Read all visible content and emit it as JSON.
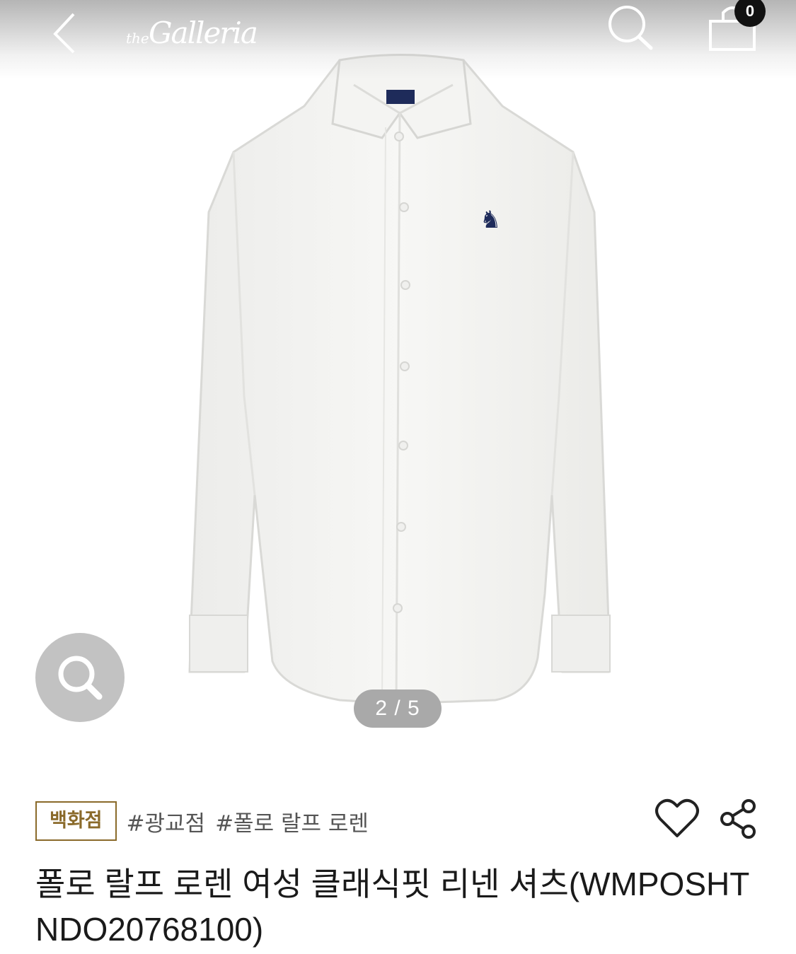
{
  "header": {
    "back_icon": "chevron-left-icon",
    "logo_prefix": "the",
    "logo_name": "Galleria",
    "search_icon": "search-icon",
    "cart_icon": "shopping-bag-icon",
    "cart_count": "0"
  },
  "gallery": {
    "zoom_icon": "magnifier-icon",
    "pager": "2 / 5"
  },
  "product": {
    "department_badge": "백화점",
    "tags": [
      "#광교점",
      "#폴로 랄프 로렌"
    ],
    "like_icon": "heart-icon",
    "share_icon": "share-icon",
    "title": "폴로 랄프 로렌 여성 클래식핏 리넨 셔츠(WMPOSHTNDO20768100)"
  },
  "colors": {
    "badge_gold": "#8a6a2a",
    "cart_badge": "#111111",
    "pager_bg": "#a9a9a9",
    "zoom_bg": "#c2c2c2"
  }
}
